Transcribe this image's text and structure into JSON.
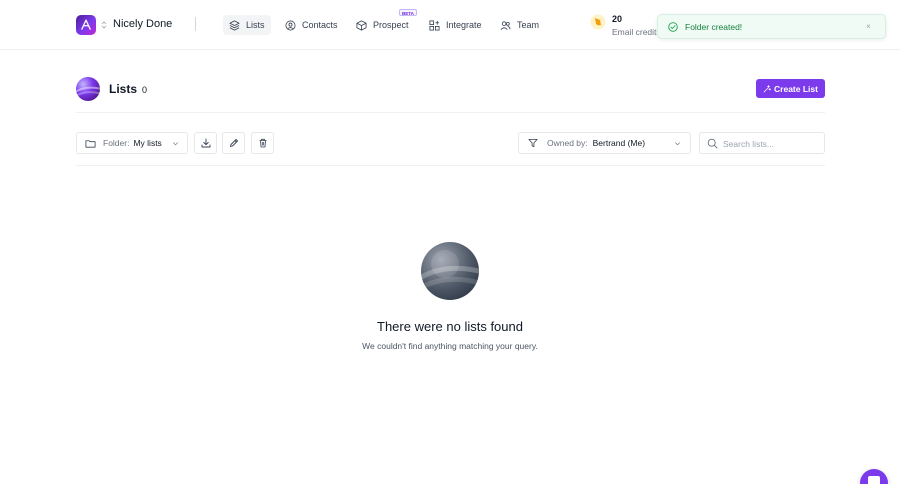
{
  "workspace": {
    "name": "Nicely Done"
  },
  "nav": {
    "items": [
      {
        "label": "Lists",
        "icon": "layers-icon",
        "active": true
      },
      {
        "label": "Contacts",
        "icon": "user-icon",
        "active": false
      },
      {
        "label": "Prospect",
        "icon": "box-icon",
        "active": false,
        "badge": "BETA"
      },
      {
        "label": "Integrate",
        "icon": "grid-plus-icon",
        "active": false
      },
      {
        "label": "Team",
        "icon": "users-icon",
        "active": false
      }
    ]
  },
  "credits": {
    "value": "20",
    "label": "Email credits"
  },
  "toast": {
    "message": "Folder created!",
    "close": "×"
  },
  "header": {
    "title": "Lists",
    "count": "0",
    "create_label": "Create List"
  },
  "toolbar": {
    "folder_label": "Folder:",
    "folder_value": "My lists",
    "owner_label": "Owned by:",
    "owner_value": "Bertrand (Me)",
    "search_placeholder": "Search lists..."
  },
  "empty": {
    "title": "There were no lists found",
    "subtitle": "We couldn't find anything matching your query."
  },
  "colors": {
    "accent": "#7c3aed",
    "success": "#15803d",
    "toast_bg": "#f0fbf5"
  }
}
